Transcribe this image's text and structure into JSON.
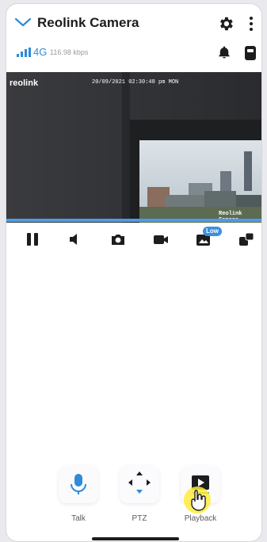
{
  "header": {
    "title": "Reolink Camera",
    "back_icon": "chevron-down-icon",
    "settings_icon": "gear-icon",
    "more_icon": "vertical-dots-icon"
  },
  "status": {
    "network": "4G",
    "bitrate": "116.98 kbps",
    "notification_icon": "bell-icon",
    "device_icon": "camera-device-icon"
  },
  "video": {
    "brand_logo": "reolink",
    "timestamp": "20/09/2021 02:30:48 pm MON",
    "watermark": "Reolink Camera",
    "progress_percent": 100
  },
  "toolbar": {
    "quality_badge": "Low",
    "items": [
      "pause-icon",
      "speaker-icon",
      "snapshot-icon",
      "record-icon",
      "quality-icon",
      "display-mode-icon"
    ]
  },
  "actions": [
    {
      "label": "Talk",
      "icon": "microphone-icon"
    },
    {
      "label": "PTZ",
      "icon": "ptz-arrows-icon"
    },
    {
      "label": "Playback",
      "icon": "playback-icon"
    }
  ],
  "colors": {
    "accent": "#2f8bd9",
    "progress": "#4c9ce6",
    "badge": "#3b8fe0",
    "cursor_highlight": "#ffeb3b"
  }
}
